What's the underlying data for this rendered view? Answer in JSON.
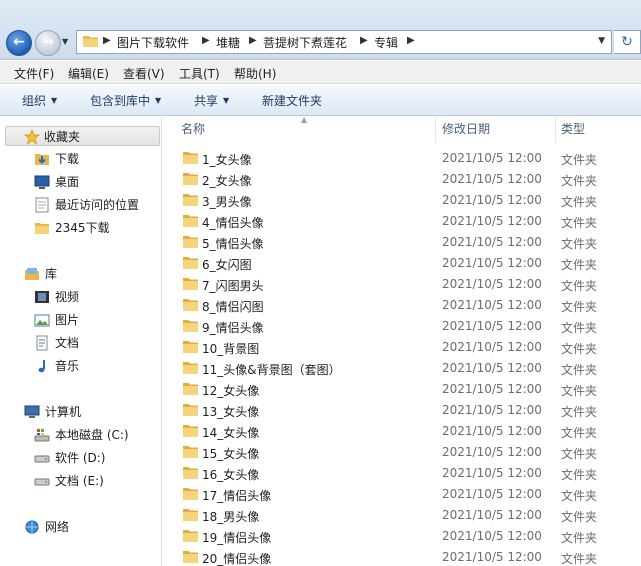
{
  "address": {
    "crumbs": [
      "图片下载软件",
      "堆糖",
      "菩提树下煮莲花",
      "专辑"
    ]
  },
  "menu": [
    "文件(F)",
    "编辑(E)",
    "查看(V)",
    "工具(T)",
    "帮助(H)"
  ],
  "toolbar": {
    "organize": "组织",
    "include": "包含到库中",
    "share": "共享",
    "new_folder": "新建文件夹"
  },
  "sidebar": {
    "favorites": "收藏夹",
    "downloads": "下载",
    "desktop": "桌面",
    "recent": "最近访问的位置",
    "dl2345": "2345下载",
    "libraries": "库",
    "videos": "视频",
    "pictures": "图片",
    "documents": "文档",
    "music": "音乐",
    "computer": "计算机",
    "drive_c": "本地磁盘 (C:)",
    "drive_d": "软件 (D:)",
    "drive_e": "文档 (E:)",
    "network": "网络"
  },
  "columns": {
    "name": "名称",
    "date": "修改日期",
    "type": "类型"
  },
  "files": [
    {
      "name": "1_女头像",
      "date": "2021/10/5 12:00",
      "type": "文件夹"
    },
    {
      "name": "2_女头像",
      "date": "2021/10/5 12:00",
      "type": "文件夹"
    },
    {
      "name": "3_男头像",
      "date": "2021/10/5 12:00",
      "type": "文件夹"
    },
    {
      "name": "4_情侣头像",
      "date": "2021/10/5 12:00",
      "type": "文件夹"
    },
    {
      "name": "5_情侣头像",
      "date": "2021/10/5 12:00",
      "type": "文件夹"
    },
    {
      "name": "6_女闪图",
      "date": "2021/10/5 12:00",
      "type": "文件夹"
    },
    {
      "name": "7_闪图男头",
      "date": "2021/10/5 12:00",
      "type": "文件夹"
    },
    {
      "name": "8_情侣闪图",
      "date": "2021/10/5 12:00",
      "type": "文件夹"
    },
    {
      "name": "9_情侣头像",
      "date": "2021/10/5 12:00",
      "type": "文件夹"
    },
    {
      "name": "10_背景图",
      "date": "2021/10/5 12:00",
      "type": "文件夹"
    },
    {
      "name": "11_头像&背景图（套图）",
      "date": "2021/10/5 12:00",
      "type": "文件夹"
    },
    {
      "name": "12_女头像",
      "date": "2021/10/5 12:00",
      "type": "文件夹"
    },
    {
      "name": "13_女头像",
      "date": "2021/10/5 12:00",
      "type": "文件夹"
    },
    {
      "name": "14_女头像",
      "date": "2021/10/5 12:00",
      "type": "文件夹"
    },
    {
      "name": "15_女头像",
      "date": "2021/10/5 12:00",
      "type": "文件夹"
    },
    {
      "name": "16_女头像",
      "date": "2021/10/5 12:00",
      "type": "文件夹"
    },
    {
      "name": "17_情侣头像",
      "date": "2021/10/5 12:00",
      "type": "文件夹"
    },
    {
      "name": "18_男头像",
      "date": "2021/10/5 12:00",
      "type": "文件夹"
    },
    {
      "name": "19_情侣头像",
      "date": "2021/10/5 12:00",
      "type": "文件夹"
    },
    {
      "name": "20_情侣头像",
      "date": "2021/10/5 12:00",
      "type": "文件夹"
    }
  ]
}
